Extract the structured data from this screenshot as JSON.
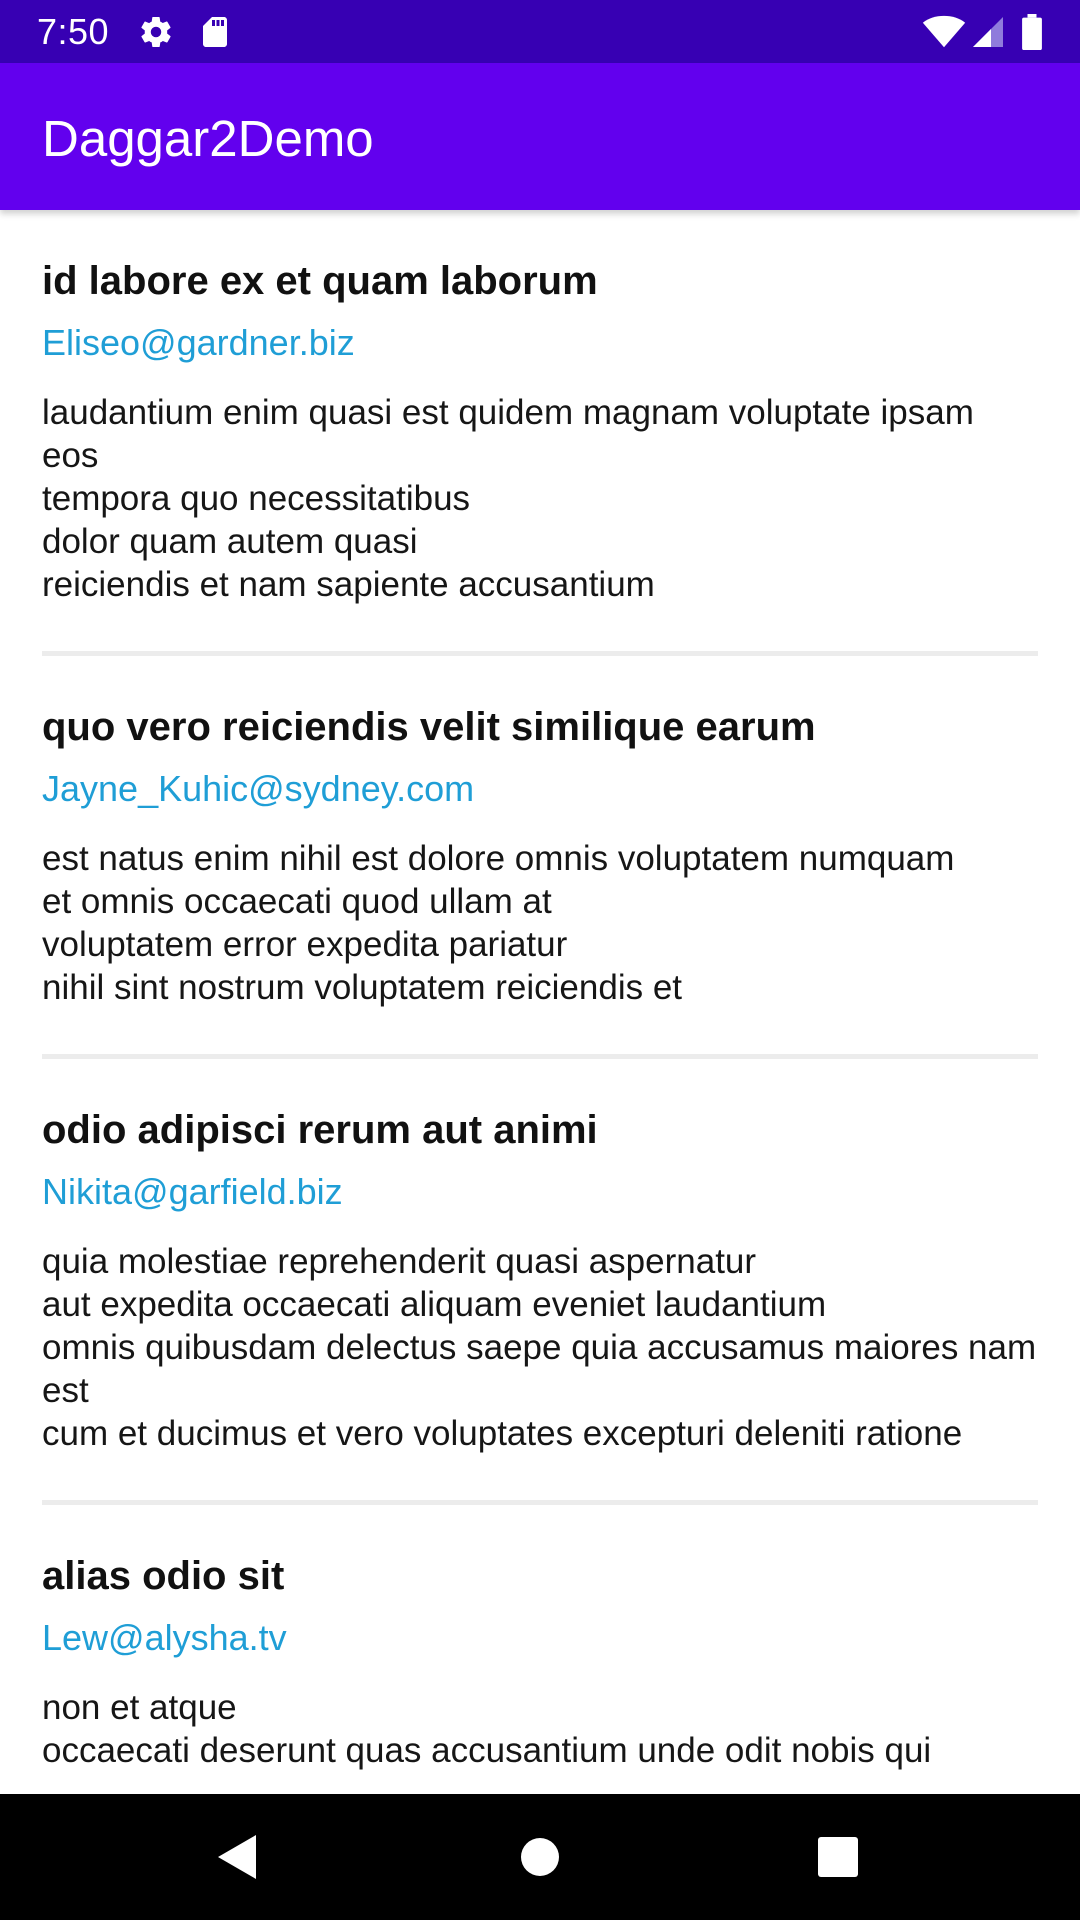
{
  "status_bar": {
    "time": "7:50",
    "icons": [
      "gear-icon",
      "sd-card-icon",
      "wifi-icon",
      "signal-icon",
      "battery-icon"
    ],
    "background": "#3700b3"
  },
  "app_bar": {
    "title": "Daggar2Demo",
    "background": "#6200ee"
  },
  "posts": [
    {
      "title": "id labore ex et quam laborum",
      "email": "Eliseo@gardner.biz",
      "body": "laudantium enim quasi est quidem magnam voluptate ipsam eos\ntempora quo necessitatibus\ndolor quam autem quasi\nreiciendis et nam sapiente accusantium"
    },
    {
      "title": "quo vero reiciendis velit similique earum",
      "email": "Jayne_Kuhic@sydney.com",
      "body": "est natus enim nihil est dolore omnis voluptatem numquam\net omnis occaecati quod ullam at\nvoluptatem error expedita pariatur\nnihil sint nostrum voluptatem reiciendis et"
    },
    {
      "title": "odio adipisci rerum aut animi",
      "email": "Nikita@garfield.biz",
      "body": "quia molestiae reprehenderit quasi aspernatur\naut expedita occaecati aliquam eveniet laudantium\nomnis quibusdam delectus saepe quia accusamus maiores nam est\ncum et ducimus et vero voluptates excepturi deleniti ratione"
    },
    {
      "title": "alias odio sit",
      "email": "Lew@alysha.tv",
      "body": "non et atque\noccaecati deserunt quas accusantium unde odit nobis qui"
    }
  ],
  "colors": {
    "email": "#1f9ed6",
    "divider": "#ececec"
  },
  "nav_bar": {
    "buttons": [
      "back-icon",
      "home-icon",
      "recents-icon"
    ]
  }
}
